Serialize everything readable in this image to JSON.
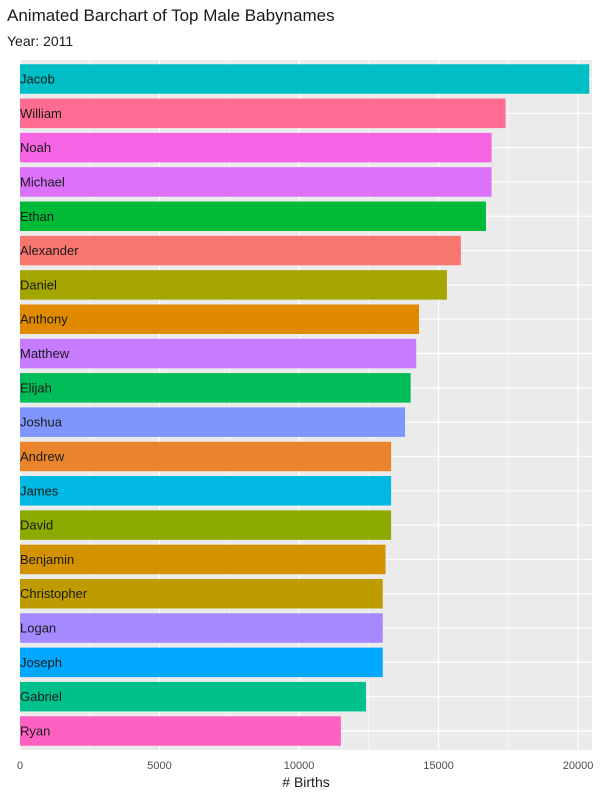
{
  "chart_data": {
    "type": "bar",
    "orientation": "horizontal",
    "title": "Animated Barchart of Top Male Babynames",
    "subtitle": "Year: 2011",
    "xlabel": "# Births",
    "ylabel": "",
    "xlim": [
      0,
      20500
    ],
    "xticks": [
      0,
      5000,
      10000,
      15000,
      20000
    ],
    "grid": true,
    "legend": "none",
    "categories": [
      "Jacob",
      "William",
      "Noah",
      "Michael",
      "Ethan",
      "Alexander",
      "Daniel",
      "Anthony",
      "Matthew",
      "Elijah",
      "Joshua",
      "Andrew",
      "James",
      "David",
      "Benjamin",
      "Christopher",
      "Logan",
      "Joseph",
      "Gabriel",
      "Ryan"
    ],
    "values": [
      20400,
      17400,
      16900,
      16900,
      16700,
      15800,
      15300,
      14300,
      14200,
      14000,
      13800,
      13300,
      13300,
      13300,
      13100,
      13000,
      13000,
      13000,
      12400,
      11500
    ],
    "colors": [
      "#00BFC4",
      "#FF6C91",
      "#F564E3",
      "#DC71FA",
      "#00BA38",
      "#F8766D",
      "#A3A500",
      "#E18A00",
      "#C77CFF",
      "#00BC59",
      "#7F96FF",
      "#E9842C",
      "#00B9E3",
      "#8BAB00",
      "#D39200",
      "#BE9C00",
      "#A58AFF",
      "#00A9FF",
      "#00C08B",
      "#FF61C3"
    ]
  }
}
